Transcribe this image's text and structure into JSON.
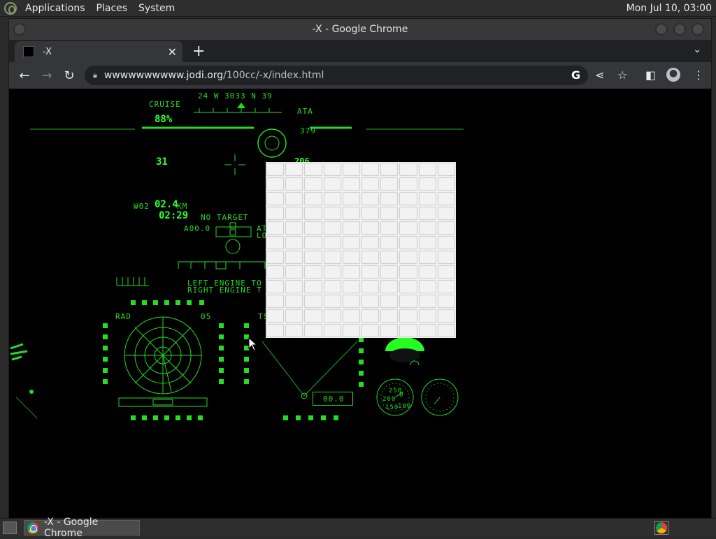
{
  "top_panel": {
    "menus": [
      "Applications",
      "Places",
      "System"
    ],
    "clock": "Mon Jul 10, 03:00"
  },
  "window": {
    "title": "-X - Google Chrome"
  },
  "browser": {
    "tab_title": "-X",
    "url_host": "wwwwwwwwww.jodi.org",
    "url_path": "/100cc/-x/index.html"
  },
  "hud": {
    "heading": "24 W 3033 N 39",
    "cruise": "CRUISE",
    "throttle": "88%",
    "ata": "ATA",
    "range_379": "379",
    "value_31": "31",
    "value_206": "206",
    "wp": "W02",
    "distance": "02.4",
    "distance_unit": "KM",
    "time": "02:29",
    "no_target": "NO TARGET",
    "a00": "A00.0",
    "at": "AT",
    "lo": "LO",
    "left_engine": "LEFT ENGINE TO",
    "right_engine": "RIGHT ENGINE T",
    "rad": "RAD",
    "rad_range": "05",
    "ts": "TS",
    "readout": "00.0",
    "gauge_values": [
      "250",
      "200",
      "150",
      "100",
      "0"
    ]
  },
  "taskbar": {
    "task_label": "-X - Google Chrome"
  }
}
